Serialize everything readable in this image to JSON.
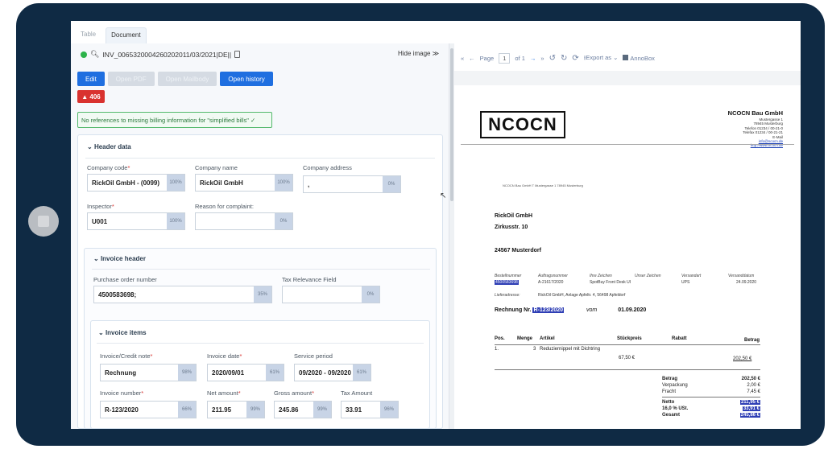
{
  "tabs": {
    "table": "Table",
    "document": "Document"
  },
  "doc": {
    "id": "INV_0065320004260202011/03/2021|DE||",
    "hide_image": "Hide image ≫"
  },
  "buttons": {
    "edit": "Edit",
    "open_pdf": "Open PDF",
    "open_mailbody": "Open Mailbody",
    "open_history": "Open history"
  },
  "alert": "▲ 406",
  "ok_message": "No references to missing billing information for \"simplified bills\" ✓",
  "header_data": {
    "title": "Header data",
    "company_code": {
      "label": "Company code",
      "value": "RickOil GmbH - (0099)",
      "pct": "100%"
    },
    "company_name": {
      "label": "Company name",
      "value": "RickOil GmbH",
      "pct": "100%"
    },
    "company_address": {
      "label": "Company address",
      "value": ",",
      "pct": "0%"
    },
    "inspector": {
      "label": "Inspector",
      "value": "U001",
      "pct": "100%"
    },
    "reason": {
      "label": "Reason for complaint:",
      "value": "",
      "pct": "0%"
    }
  },
  "invoice_header": {
    "title": "Invoice header",
    "po": {
      "label": "Purchase order number",
      "value": "4500583698;",
      "pct": "35%"
    },
    "tax": {
      "label": "Tax Relevance Field",
      "value": "",
      "pct": "0%"
    }
  },
  "invoice_items": {
    "title": "Invoice items",
    "note": {
      "label": "Invoice/Credit note",
      "value": "Rechnung",
      "pct": "98%"
    },
    "date": {
      "label": "Invoice date",
      "value": "2020/09/01",
      "pct": "61%"
    },
    "service": {
      "label": "Service period",
      "value": "09/2020 - 09/2020",
      "pct": "61%"
    },
    "number": {
      "label": "Invoice number",
      "value": "R-123/2020",
      "pct": "66%"
    },
    "net": {
      "label": "Net amount",
      "value": "211.95",
      "pct": "99%"
    },
    "gross": {
      "label": "Gross amount",
      "value": "245.86",
      "pct": "99%"
    },
    "taxamt": {
      "label": "Tax Amount",
      "value": "33.91",
      "pct": "96%"
    }
  },
  "viewer": {
    "page_label": "Page",
    "page": "1",
    "of": "of 1",
    "export": "Export as",
    "annobox": "AnnoBox"
  },
  "invoice": {
    "logo": "NCOCN",
    "company": "NCOCN Bau GmbH",
    "addr": [
      "Mustergasse 1",
      "78945 Musterburg",
      "Telefon 01234 / 00-21-0",
      "Telefax 01234 / 00-21-21",
      "E-Mail"
    ],
    "links": [
      "info@ncocn.de",
      "http://www.ncocn.de"
    ],
    "sender": "NCOCN Bau GmbH T Mustergasse 1 78945 Musterburg",
    "recipient": [
      "RickOil GmbH",
      "Zirkusstr. 10",
      "24567 Musterdorf"
    ],
    "meta_heads": [
      "Bestellnummer",
      "Auftragsnummer",
      "Ihre Zeichen",
      "Unser Zeichen",
      "Versandart",
      "Versanddatum"
    ],
    "meta_vals": {
      "order": "4500583698",
      "auftrag": "A-21617/2020",
      "zeichen": "SpotBuy Front Desk UI",
      "versand": "UPS",
      "datum": "24.09.2020"
    },
    "liefer_label": "Lieferadresse:",
    "liefer": "RickOil GmbH, Anlage Apfeltr. 4, 56498 Apfeldorf",
    "rnr_label": "Rechnung Nr.",
    "rnr": "R-123/2020",
    "vom": "vom",
    "rdate": "01.09.2020",
    "cols": [
      "Pos.",
      "Menge",
      "Artikel",
      "Stückpreis",
      "Rabatt",
      "Betrag"
    ],
    "row": {
      "pos": "1.",
      "menge": "3",
      "artikel": "Reduziernippel mit Dichtring",
      "preis": "67,50 €",
      "betrag": "202,50 €"
    },
    "totals": [
      {
        "k": "Betrag",
        "v": "202,50 €"
      },
      {
        "k": "Verpackung",
        "v": "2,00 €"
      },
      {
        "k": "Fracht",
        "v": "7,45 €"
      },
      {
        "k": "Netto",
        "v": "211,95 €"
      },
      {
        "k": "16,0 % USt.",
        "v": "33,91 €"
      },
      {
        "k": "Gesamt",
        "v": "245,86 €"
      }
    ]
  }
}
